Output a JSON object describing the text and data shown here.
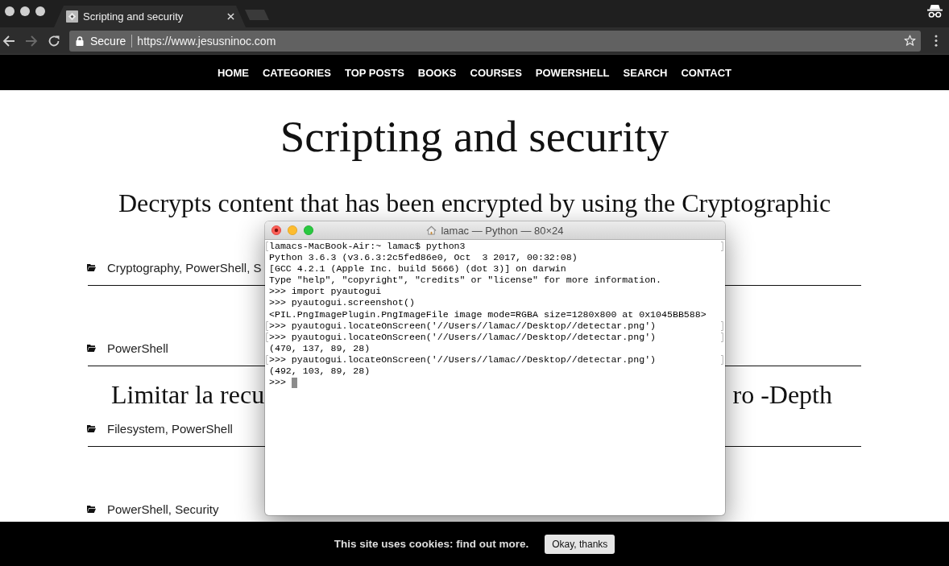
{
  "browser": {
    "tab": {
      "title": "Scripting and security"
    },
    "address_bar": {
      "security_label": "Secure",
      "url": "https://www.jesusninoc.com"
    }
  },
  "nav": {
    "items": [
      "HOME",
      "CATEGORIES",
      "TOP POSTS",
      "BOOKS",
      "COURSES",
      "POWERSHELL",
      "SEARCH",
      "CONTACT"
    ]
  },
  "page": {
    "title": "Scripting and security",
    "posts": [
      {
        "heading": [
          "Decrypts content that has been encrypted by using the Cryptographic"
        ],
        "categories": "Cryptography, PowerShell, S"
      },
      {
        "categories": "PowerShell"
      },
      {
        "heading": [
          "Limitar la recu",
          "ro -Depth"
        ],
        "categories": "Filesystem, PowerShell"
      },
      {
        "categories": "PowerShell, Security"
      }
    ]
  },
  "terminal": {
    "title": "lamac — Python — 80×24",
    "lines": [
      {
        "text": "lamacs-MacBook-Air:~ lamac$ python3",
        "marked": true
      },
      {
        "text": "Python 3.6.3 (v3.6.3:2c5fed86e0, Oct  3 2017, 00:32:08)",
        "marked": false
      },
      {
        "text": "[GCC 4.2.1 (Apple Inc. build 5666) (dot 3)] on darwin",
        "marked": false
      },
      {
        "text": "Type \"help\", \"copyright\", \"credits\" or \"license\" for more information.",
        "marked": false
      },
      {
        "text": ">>> import pyautogui",
        "marked": false
      },
      {
        "text": ">>> pyautogui.screenshot()",
        "marked": false
      },
      {
        "text": "<PIL.PngImagePlugin.PngImageFile image mode=RGBA size=1280x800 at 0x1045BB588>",
        "marked": false
      },
      {
        "text": ">>> pyautogui.locateOnScreen('//Users//lamac//Desktop//detectar.png')",
        "marked": true
      },
      {
        "text": ">>> pyautogui.locateOnScreen('//Users//lamac//Desktop//detectar.png')",
        "marked": true
      },
      {
        "text": "(470, 137, 89, 28)",
        "marked": false
      },
      {
        "text": ">>> pyautogui.locateOnScreen('//Users//lamac//Desktop//detectar.png')",
        "marked": true
      },
      {
        "text": "(492, 103, 89, 28)",
        "marked": false
      }
    ],
    "prompt": ">>>",
    "cursor": true
  },
  "cookie_bar": {
    "message": "This site uses cookies: find out more.",
    "button": "Okay, thanks"
  }
}
